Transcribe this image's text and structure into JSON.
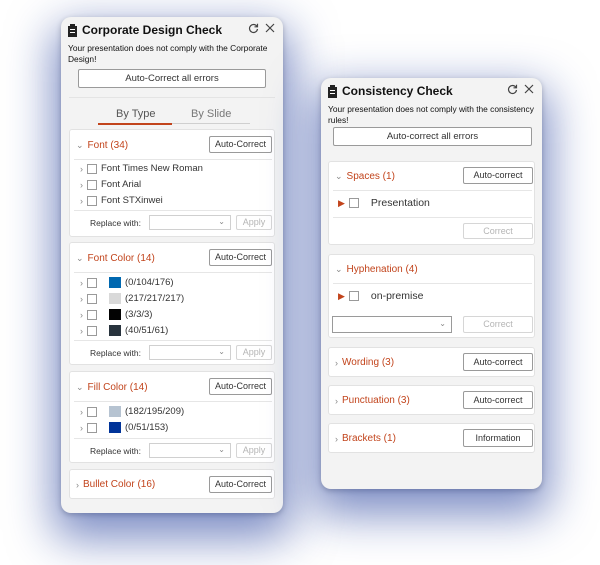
{
  "design": {
    "title": "Corporate Design Check",
    "message": "Your presentation does not comply with the Corporate Design!",
    "autocorrect_all": "Auto-Correct all errors",
    "tabs": [
      "By Type",
      "By Slide"
    ],
    "font": {
      "header": "Font (34)",
      "button": "Auto-Correct",
      "items": [
        "Font Times New Roman",
        "Font Arial",
        "Font STXinwei"
      ],
      "replace_label": "Replace with:",
      "apply": "Apply"
    },
    "font_color": {
      "header": "Font Color (14)",
      "button": "Auto-Correct",
      "items": [
        {
          "label": "(0/104/176)",
          "color": "#0068b0"
        },
        {
          "label": "(217/217/217)",
          "color": "#d9d9d9"
        },
        {
          "label": "(3/3/3)",
          "color": "#030303"
        },
        {
          "label": "(40/51/61)",
          "color": "#28333d"
        }
      ],
      "replace_label": "Replace with:",
      "apply": "Apply"
    },
    "fill_color": {
      "header": "Fill Color (14)",
      "button": "Auto-Correct",
      "items": [
        {
          "label": "(182/195/209)",
          "color": "#b6c3d1"
        },
        {
          "label": "(0/51/153)",
          "color": "#003399"
        }
      ],
      "replace_label": "Replace with:",
      "apply": "Apply"
    },
    "bullet_color": {
      "header": "Bullet Color (16)",
      "button": "Auto-Correct"
    }
  },
  "consistency": {
    "title": "Consistency Check",
    "message": "Your presentation does not comply with the consistency rules!",
    "autocorrect_all": "Auto-correct all errors",
    "spaces": {
      "header": "Spaces (1)",
      "button": "Auto-correct",
      "item": "Presentation",
      "correct": "Correct"
    },
    "hyphenation": {
      "header": "Hyphenation (4)",
      "item": "on-premise",
      "correct": "Correct"
    },
    "wording": {
      "header": "Wording (3)",
      "button": "Auto-correct"
    },
    "punctuation": {
      "header": "Punctuation (3)",
      "button": "Auto-correct"
    },
    "brackets": {
      "header": "Brackets (1)",
      "button": "Information"
    }
  },
  "colors": {
    "accent": "#c2441c",
    "tab_underline": "#c2441c"
  }
}
